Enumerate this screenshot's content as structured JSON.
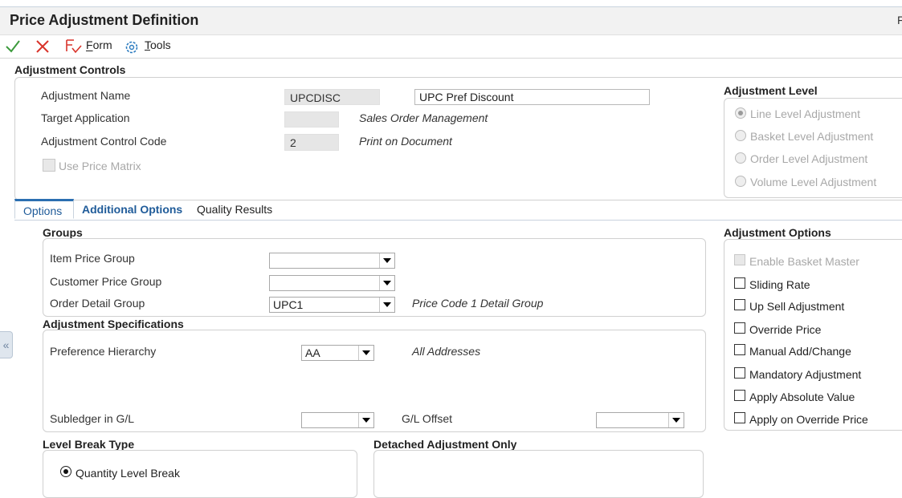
{
  "window": {
    "title": "Price Adjustment Definition",
    "title_right": "F"
  },
  "toolbar": {
    "form_label": "Form",
    "tools_label": "Tools",
    "form_underline": "F",
    "tools_underline": "T"
  },
  "adjustment_controls": {
    "heading": "Adjustment Controls",
    "adjustment_name_label": "Adjustment Name",
    "adjustment_name_code": "UPCDISC",
    "adjustment_name_desc": "UPC Pref Discount",
    "target_application_label": "Target Application",
    "target_application_code": "",
    "target_application_desc": "Sales Order Management",
    "control_code_label": "Adjustment Control Code",
    "control_code_value": "2",
    "control_code_desc": "Print on Document",
    "use_price_matrix_label": "Use Price Matrix"
  },
  "adjustment_level": {
    "heading": "Adjustment Level",
    "options": [
      "Line Level Adjustment",
      "Basket Level Adjustment",
      "Order Level Adjustment",
      "Volume Level Adjustment"
    ],
    "selected": "Line Level Adjustment"
  },
  "tabs": {
    "options": "Options",
    "additional_options": "Additional Options",
    "quality_results": "Quality Results",
    "active": "Options"
  },
  "groups": {
    "heading": "Groups",
    "item_price_group_label": "Item Price Group",
    "item_price_group_value": "",
    "customer_price_group_label": "Customer Price Group",
    "customer_price_group_value": "",
    "order_detail_group_label": "Order Detail Group",
    "order_detail_group_value": "UPC1",
    "order_detail_group_desc": "Price Code 1 Detail Group"
  },
  "adjustment_specs": {
    "heading": "Adjustment Specifications",
    "preference_hierarchy_label": "Preference Hierarchy",
    "preference_hierarchy_value": "AA",
    "preference_hierarchy_desc": "All Addresses",
    "subledger_label": "Subledger in G/L",
    "subledger_value": "",
    "gl_offset_label": "G/L Offset",
    "gl_offset_value": ""
  },
  "level_break": {
    "heading": "Level Break Type",
    "quantity_label": "Quantity Level Break"
  },
  "detached": {
    "heading": "Detached Adjustment Only"
  },
  "adjustment_options": {
    "heading": "Adjustment Options",
    "enable_basket_master": "Enable Basket Master",
    "sliding_rate": "Sliding Rate",
    "up_sell": "Up Sell Adjustment",
    "override_price": "Override Price",
    "manual_add_change": "Manual Add/Change",
    "mandatory": "Mandatory Adjustment",
    "apply_absolute": "Apply Absolute Value",
    "apply_on_override": "Apply on Override Price"
  },
  "sidebar": {
    "toggle_glyph": "«"
  }
}
